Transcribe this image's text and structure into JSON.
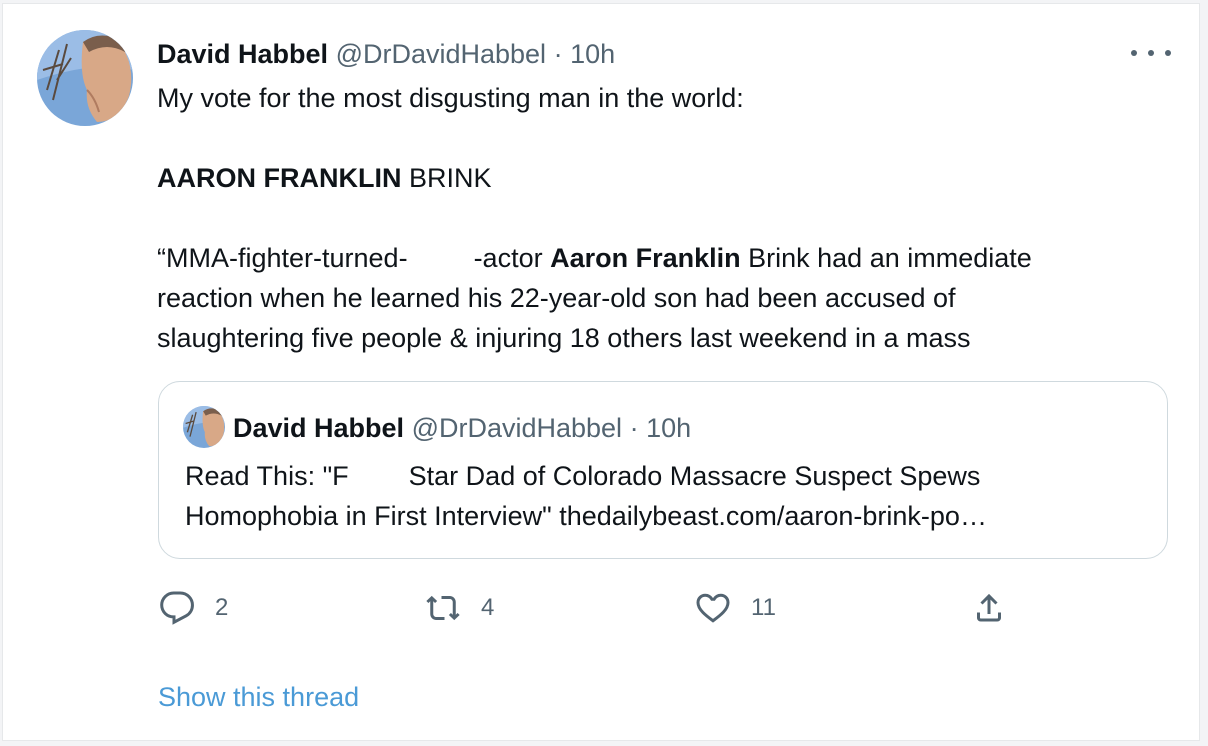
{
  "tweet": {
    "author_name": "David Habbel",
    "author_handle": "@DrDavidHabbel",
    "separator": " · ",
    "time": "10h",
    "line1": "My vote for the most disgusting man in the world:",
    "line2_bold": "AARON FRANKLIN",
    "line2_rest": " BRINK",
    "line3_a": "“MMA-fighter-turned-",
    "line3_b": "-actor ",
    "line3_bold": "Aaron Franklin",
    "line3_c": " Brink had an immediate",
    "line4": "reaction when he learned his 22-year-old son had been accused of",
    "line5": "slaughtering five people & injuring 18 others last weekend in a mass"
  },
  "quoted": {
    "author_name": "David Habbel",
    "author_handle": "@DrDavidHabbel",
    "separator": " · ",
    "time": "10h",
    "line1_a": "Read This: \"F",
    "line1_b": "Star Dad of Colorado Massacre Suspect Spews",
    "line2": "Homophobia in First Interview\" thedailybeast.com/aaron-brink-po…"
  },
  "actions": {
    "replies": "2",
    "retweets": "4",
    "likes": "11"
  },
  "show_thread": "Show this thread",
  "colors": {
    "text": "#0f1419",
    "muted": "#536471",
    "link": "#4a9ad6",
    "border": "#cfd9de"
  },
  "icons": [
    "more-icon",
    "reply-icon",
    "retweet-icon",
    "like-icon",
    "share-icon"
  ]
}
